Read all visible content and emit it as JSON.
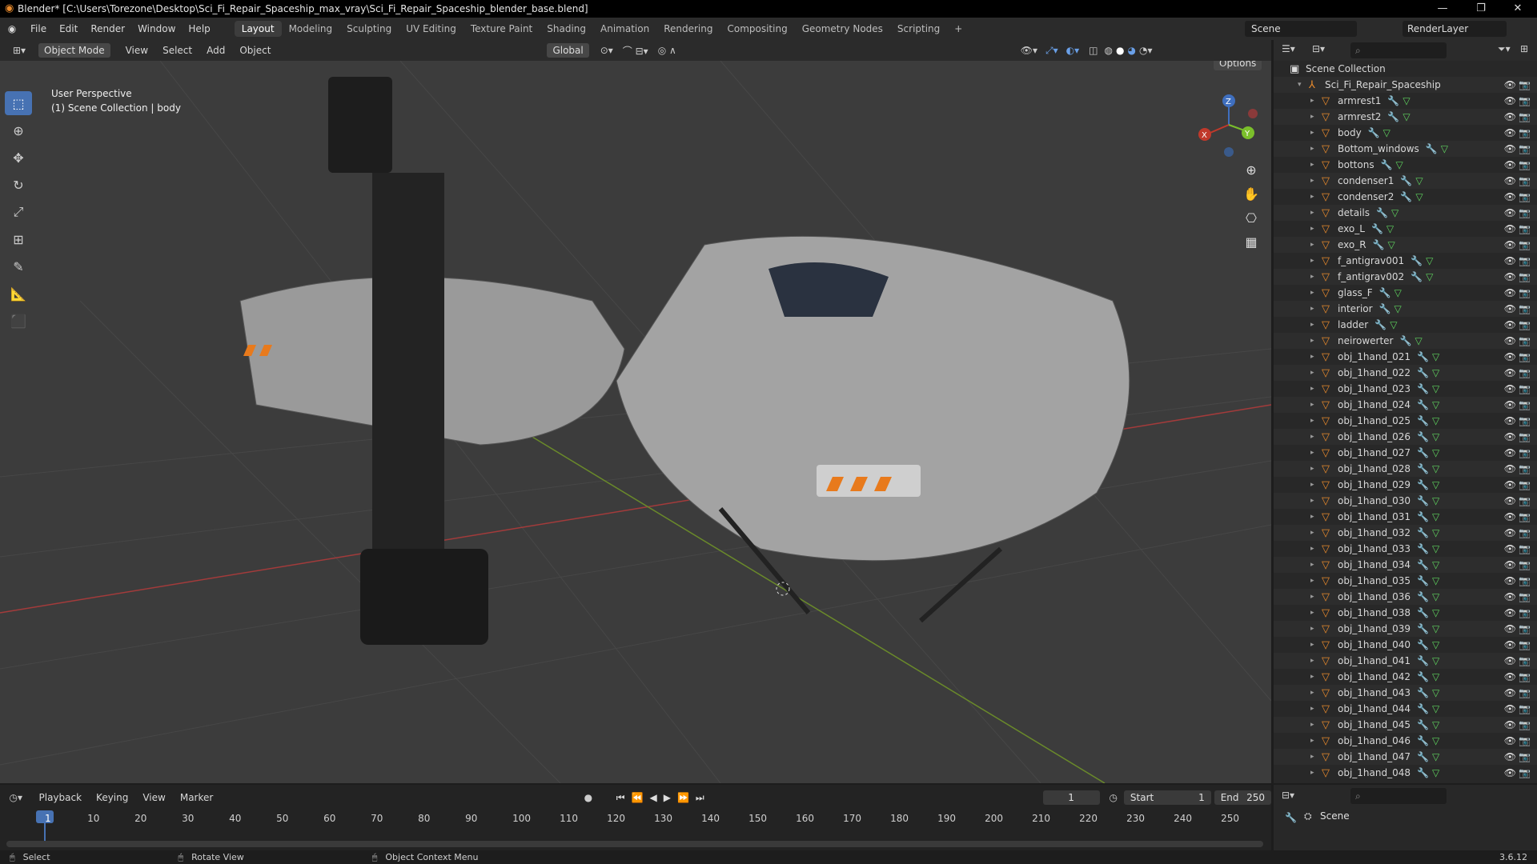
{
  "titlebar": {
    "title": "Blender* [C:\\Users\\Torezone\\Desktop\\Sci_Fi_Repair_Spaceship_max_vray\\Sci_Fi_Repair_Spaceship_blender_base.blend]"
  },
  "menus": [
    "File",
    "Edit",
    "Render",
    "Window",
    "Help"
  ],
  "workspaces": [
    "Layout",
    "Modeling",
    "Sculpting",
    "UV Editing",
    "Texture Paint",
    "Shading",
    "Animation",
    "Rendering",
    "Compositing",
    "Geometry Nodes",
    "Scripting"
  ],
  "active_workspace": "Layout",
  "scene": "Scene",
  "view_layer": "RenderLayer",
  "viewport": {
    "mode": "Object Mode",
    "menus": [
      "View",
      "Select",
      "Add",
      "Object"
    ],
    "orientation": "Global",
    "options": "Options",
    "perspective": "User Perspective",
    "context": "(1) Scene Collection | body"
  },
  "outliner": {
    "root": "Scene Collection",
    "object": "Sci_Fi_Repair_Spaceship",
    "items": [
      "armrest1",
      "armrest2",
      "body",
      "Bottom_windows",
      "bottons",
      "condenser1",
      "condenser2",
      "details",
      "exo_L",
      "exo_R",
      "f_antigrav001",
      "f_antigrav002",
      "glass_F",
      "interior",
      "ladder",
      "neirowerter",
      "obj_1hand_021",
      "obj_1hand_022",
      "obj_1hand_023",
      "obj_1hand_024",
      "obj_1hand_025",
      "obj_1hand_026",
      "obj_1hand_027",
      "obj_1hand_028",
      "obj_1hand_029",
      "obj_1hand_030",
      "obj_1hand_031",
      "obj_1hand_032",
      "obj_1hand_033",
      "obj_1hand_034",
      "obj_1hand_035",
      "obj_1hand_036",
      "obj_1hand_038",
      "obj_1hand_039",
      "obj_1hand_040",
      "obj_1hand_041",
      "obj_1hand_042",
      "obj_1hand_043",
      "obj_1hand_044",
      "obj_1hand_045",
      "obj_1hand_046",
      "obj_1hand_047",
      "obj_1hand_048"
    ]
  },
  "timeline": {
    "menus": [
      "Playback",
      "Keying",
      "View",
      "Marker"
    ],
    "current_frame": "1",
    "start_label": "Start",
    "start": "1",
    "end_label": "End",
    "end": "250",
    "ticks": [
      "1",
      "10",
      "20",
      "30",
      "40",
      "50",
      "60",
      "70",
      "80",
      "90",
      "100",
      "110",
      "120",
      "130",
      "140",
      "150",
      "160",
      "170",
      "180",
      "190",
      "200",
      "210",
      "220",
      "230",
      "240",
      "250"
    ]
  },
  "properties": {
    "scene": "Scene"
  },
  "statusbar": {
    "select": "Select",
    "rotate": "Rotate View",
    "context_menu": "Object Context Menu",
    "version": "3.6.12"
  }
}
